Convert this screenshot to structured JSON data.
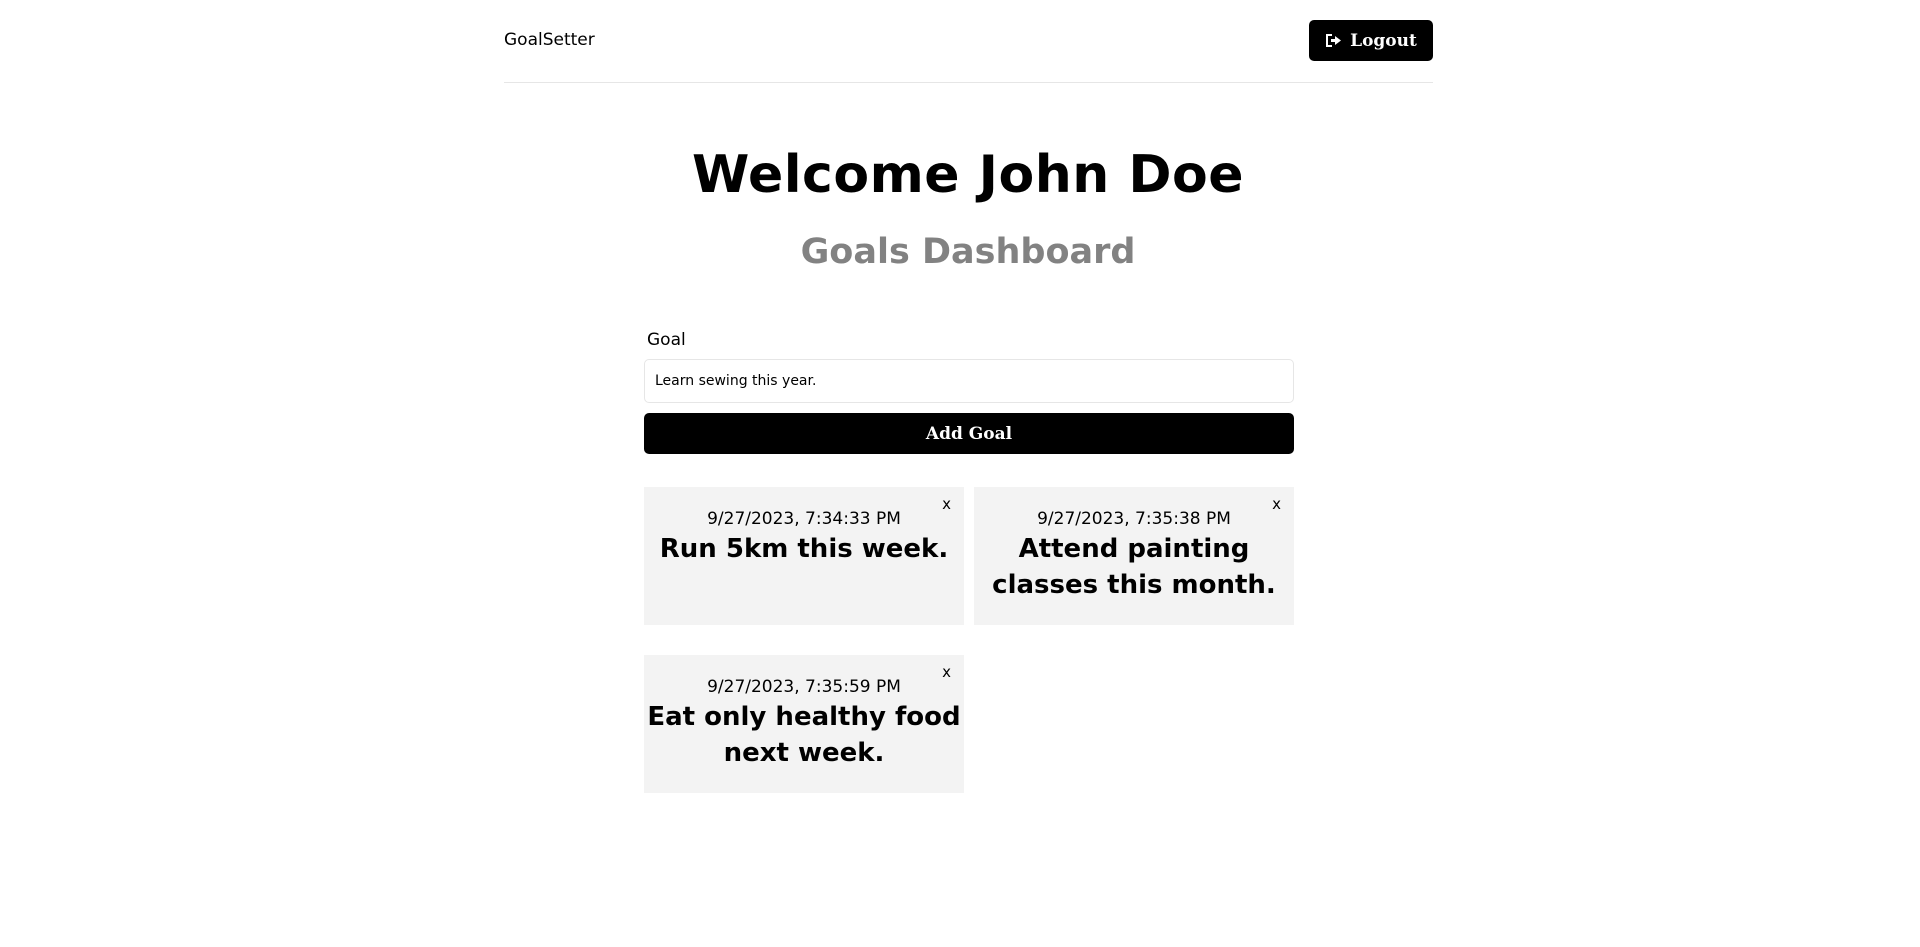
{
  "header": {
    "logo": "GoalSetter",
    "logout_label": "Logout",
    "logout_icon": "sign-out-icon"
  },
  "main": {
    "welcome": "Welcome John Doe",
    "subtitle": "Goals Dashboard"
  },
  "form": {
    "label": "Goal",
    "input_value": "Learn sewing this year.",
    "add_button_label": "Add Goal"
  },
  "goals": [
    {
      "date": "9/27/2023, 7:34:33 PM",
      "text": "Run 5km this week.",
      "close": "x"
    },
    {
      "date": "9/27/2023, 7:35:38 PM",
      "text": "Attend painting classes this month.",
      "close": "x"
    },
    {
      "date": "9/27/2023, 7:35:59 PM",
      "text": "Eat only healthy food next week.",
      "close": "x"
    }
  ],
  "colors": {
    "primary": "#000000",
    "card_background": "#f3f3f3",
    "subtitle": "#828282"
  }
}
